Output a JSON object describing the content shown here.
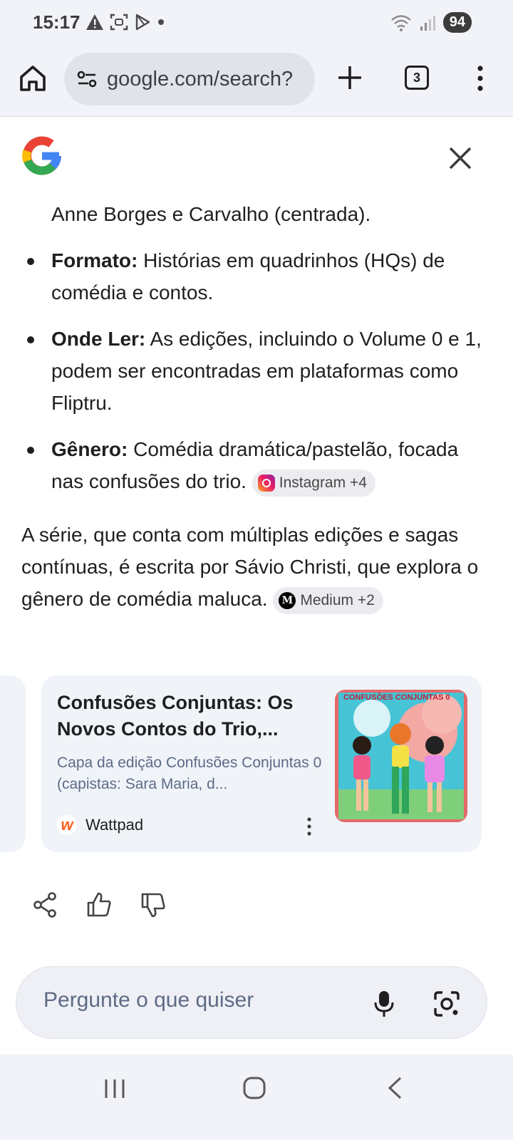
{
  "status_bar": {
    "time": "15:17",
    "battery": "94"
  },
  "browser": {
    "url": "google.com/search?",
    "tab_count": "3"
  },
  "answer": {
    "continued_line": "Anne Borges e Carvalho (centrada).",
    "bullets": [
      {
        "label": "Formato:",
        "text": " Histórias em quadrinhos (HQs) de comédia e contos."
      },
      {
        "label": "Onde Ler:",
        "text": " As edições, incluindo o Volume 0 e 1, podem ser encontradas em plataformas como Fliptru."
      },
      {
        "label": "Gênero:",
        "text": " Comédia dramática/pastelão, focada nas confusões do trio. "
      }
    ],
    "bullet_chip": "Instagram +4",
    "paragraph": "A série, que conta com múltiplas edições e sagas contínuas, é escrita por Sávio Christi, que explora o gênero de comédia maluca. ",
    "paragraph_chip": "Medium +2"
  },
  "source_card": {
    "title": "Confusões Conjuntas: Os Novos Contos do Trio,...",
    "description": "Capa da edição Confusões Conjuntas 0 (capistas: Sara Maria, d...",
    "source_name": "Wattpad",
    "thumb_caption": "CONFUSÕES CONJUNTAS 0"
  },
  "ask_bar": {
    "placeholder": "Pergunte o que quiser"
  },
  "colors": {
    "accent_blue": "#4285F4",
    "accent_red": "#EA4335",
    "accent_yellow": "#FBBC05",
    "accent_green": "#34A853",
    "wattpad_orange": "#FF6122"
  }
}
